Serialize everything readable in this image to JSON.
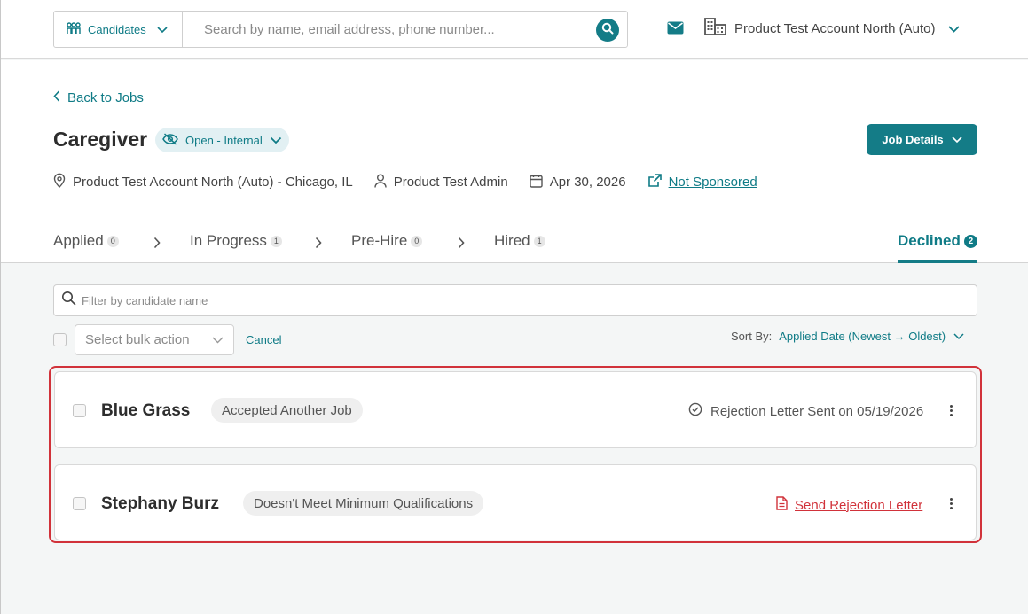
{
  "topbar": {
    "search_scope": "Candidates",
    "search_placeholder": "Search by name, email address, phone number...",
    "account_name": "Product Test Account North (Auto)"
  },
  "job": {
    "back_label": "Back to Jobs",
    "title": "Caregiver",
    "status": "Open - Internal",
    "details_button": "Job Details",
    "location": "Product Test Account North (Auto) - Chicago, IL",
    "owner": "Product Test Admin",
    "date": "Apr 30, 2026",
    "sponsorship": "Not Sponsored"
  },
  "stages": [
    {
      "label": "Applied",
      "count": "0"
    },
    {
      "label": "In Progress",
      "count": "1"
    },
    {
      "label": "Pre-Hire",
      "count": "0"
    },
    {
      "label": "Hired",
      "count": "1"
    },
    {
      "label": "Declined",
      "count": "2"
    }
  ],
  "list": {
    "filter_placeholder": "Filter by candidate name",
    "bulk_placeholder": "Select bulk action",
    "cancel_label": "Cancel",
    "sort_label": "Sort By:",
    "sort_value": "Applied Date (Newest → Oldest)"
  },
  "candidates": [
    {
      "name": "Blue Grass",
      "reason": "Accepted Another Job",
      "letter_status": "Rejection Letter Sent on 05/19/2026"
    },
    {
      "name": "Stephany Burz",
      "reason": "Doesn't Meet Minimum Qualifications",
      "letter_action": "Send Rejection Letter"
    }
  ],
  "colors": {
    "accent": "#147c87",
    "danger": "#d1323a"
  }
}
